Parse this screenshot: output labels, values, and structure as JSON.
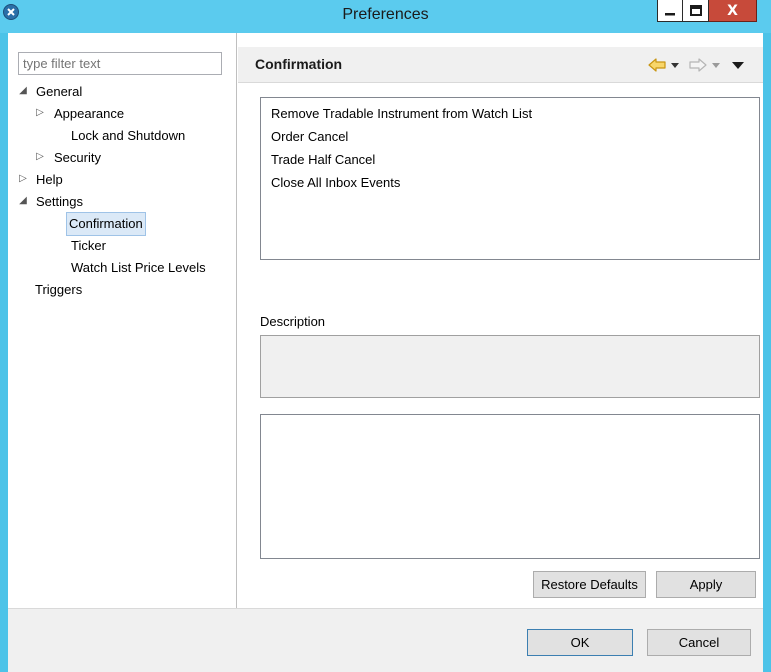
{
  "window": {
    "title": "Preferences",
    "close_label": "X"
  },
  "sidebar": {
    "filter_placeholder": "type filter text",
    "tree": [
      {
        "label": "General",
        "expanded": true,
        "level": 0,
        "has_children": true
      },
      {
        "label": "Appearance",
        "expanded": false,
        "level": 1,
        "has_children": true
      },
      {
        "label": "Lock and Shutdown",
        "level": 1,
        "has_children": false
      },
      {
        "label": "Security",
        "expanded": false,
        "level": 1,
        "has_children": true
      },
      {
        "label": "Help",
        "expanded": false,
        "level": 0,
        "has_children": true
      },
      {
        "label": "Settings",
        "expanded": true,
        "level": 0,
        "has_children": true
      },
      {
        "label": "Confirmation",
        "level": 1,
        "has_children": false,
        "selected": true
      },
      {
        "label": "Ticker",
        "level": 1,
        "has_children": false
      },
      {
        "label": "Watch List Price Levels",
        "level": 1,
        "has_children": false
      },
      {
        "label": "Triggers",
        "level": 0,
        "has_children": false
      }
    ]
  },
  "page": {
    "title": "Confirmation",
    "confirmations": [
      "Remove Tradable Instrument from Watch List",
      "Order Cancel",
      "Trade Half Cancel",
      "Close All Inbox Events"
    ],
    "description_label": "Description",
    "restore_defaults_label": "Restore Defaults",
    "apply_label": "Apply"
  },
  "footer": {
    "ok_label": "OK",
    "cancel_label": "Cancel"
  },
  "colors": {
    "titlebar": "#5bcbee",
    "nav_back_arrow": "#f2b61c",
    "selection": "#dbe9f7"
  }
}
